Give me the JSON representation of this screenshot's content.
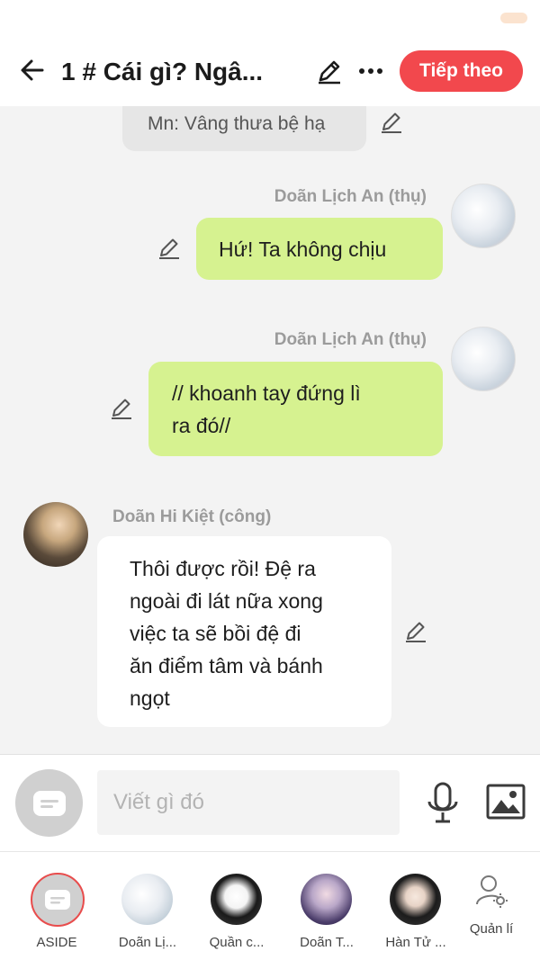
{
  "header": {
    "title": "1 # Cái gì? Ngâ...",
    "next_label": "Tiếp theo"
  },
  "chat": {
    "narration": "Mn: Vâng thưa bệ hạ",
    "messages": [
      {
        "speaker": "Doãn Lịch An (thụ)",
        "text": "Hứ! Ta không chịu",
        "side": "right"
      },
      {
        "speaker": "Doãn Lịch An (thụ)",
        "text_lines": [
          "// khoanh tay đứng lì",
          "ra đó//"
        ],
        "side": "right"
      },
      {
        "speaker": "Doãn Hi Kiệt (công)",
        "text_lines": [
          "Thôi được rồi! Đệ ra",
          "ngoài đi lát nữa xong",
          "việc ta sẽ bồi đệ đi",
          "ăn điểm tâm và bánh",
          "ngọt"
        ],
        "side": "left"
      }
    ]
  },
  "composer": {
    "placeholder": "Viết gì đó"
  },
  "characters": [
    {
      "label": "ASIDE",
      "selected": true
    },
    {
      "label": "Doãn Lị..."
    },
    {
      "label": "Quần c..."
    },
    {
      "label": "Doãn T..."
    },
    {
      "label": "Hàn Tử ..."
    },
    {
      "label": "Quản lí"
    }
  ],
  "colors": {
    "accent": "#f2484d",
    "bubble_green": "#d6f290",
    "chat_bg": "#f3f3f3"
  }
}
